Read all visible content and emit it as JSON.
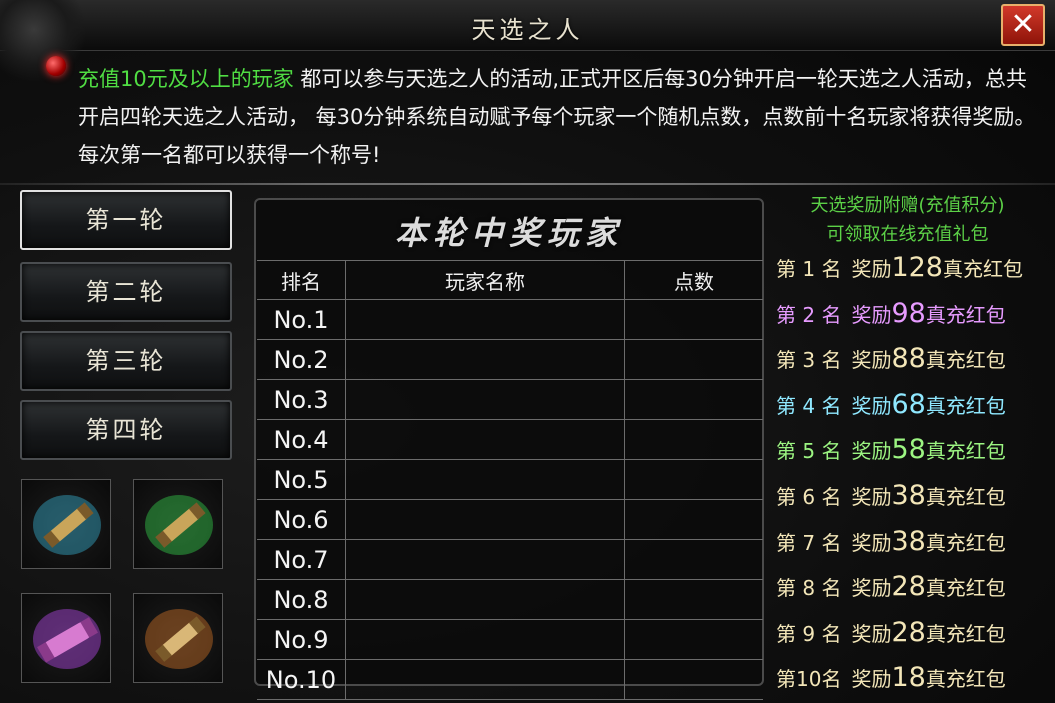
{
  "window": {
    "title": "天选之人"
  },
  "description": {
    "highlight": "充值10元及以上的玩家",
    "text": "都可以参与天选之人的活动,正式开区后每30分钟开启一轮天选之人活动，总共开启四轮天选之人活动， 每30分钟系统自动赋予每个玩家一个随机点数，点数前十名玩家将获得奖励。每次第一名都可以获得一个称号!"
  },
  "rounds": [
    "第一轮",
    "第二轮",
    "第三轮",
    "第四轮"
  ],
  "active_round": 0,
  "scrolls": [
    {
      "icon": "blue-scroll-icon",
      "color": "#3fd6ff"
    },
    {
      "icon": "green-scroll-icon",
      "color": "#3cff5a"
    },
    {
      "icon": "purple-scroll-icon",
      "color": "#c54dff"
    },
    {
      "icon": "orange-scroll-icon",
      "color": "#ff8a2a"
    }
  ],
  "winners_panel": {
    "title": "本轮中奖玩家",
    "columns": [
      "排名",
      "玩家名称",
      "点数"
    ],
    "rows": [
      {
        "rank": "No.1",
        "name": "",
        "points": ""
      },
      {
        "rank": "No.2",
        "name": "",
        "points": ""
      },
      {
        "rank": "No.3",
        "name": "",
        "points": ""
      },
      {
        "rank": "No.4",
        "name": "",
        "points": ""
      },
      {
        "rank": "No.5",
        "name": "",
        "points": ""
      },
      {
        "rank": "No.6",
        "name": "",
        "points": ""
      },
      {
        "rank": "No.7",
        "name": "",
        "points": ""
      },
      {
        "rank": "No.8",
        "name": "",
        "points": ""
      },
      {
        "rank": "No.9",
        "name": "",
        "points": ""
      },
      {
        "rank": "No.10",
        "name": "",
        "points": ""
      }
    ]
  },
  "rewards": {
    "header_line1": "天选奖励附赠(充值积分)",
    "header_line2": "可领取在线充值礼包",
    "items": [
      {
        "place": "第 1 名",
        "label": "奖励",
        "amount": "128",
        "suffix": "真充红包",
        "color": "#f3e6b8"
      },
      {
        "place": "第 2 名",
        "label": "奖励",
        "amount": "98",
        "suffix": "真充红包",
        "color": "#e79bff"
      },
      {
        "place": "第 3 名",
        "label": "奖励",
        "amount": "88",
        "suffix": "真充红包",
        "color": "#f3e6b8"
      },
      {
        "place": "第 4 名",
        "label": "奖励",
        "amount": "68",
        "suffix": "真充红包",
        "color": "#8fe8ff"
      },
      {
        "place": "第 5 名",
        "label": "奖励",
        "amount": "58",
        "suffix": "真充红包",
        "color": "#9cf582"
      },
      {
        "place": "第 6 名",
        "label": "奖励",
        "amount": "38",
        "suffix": "真充红包",
        "color": "#f3e6b8"
      },
      {
        "place": "第 7 名",
        "label": "奖励",
        "amount": "38",
        "suffix": "真充红包",
        "color": "#f3e6b8"
      },
      {
        "place": "第 8 名",
        "label": "奖励",
        "amount": "28",
        "suffix": "真充红包",
        "color": "#f3e6b8"
      },
      {
        "place": "第 9 名",
        "label": "奖励",
        "amount": "28",
        "suffix": "真充红包",
        "color": "#f3e6b8"
      },
      {
        "place": "第10名",
        "label": "奖励",
        "amount": "18",
        "suffix": "真充红包",
        "color": "#f3e6b8"
      }
    ]
  },
  "close_symbol": "✕"
}
